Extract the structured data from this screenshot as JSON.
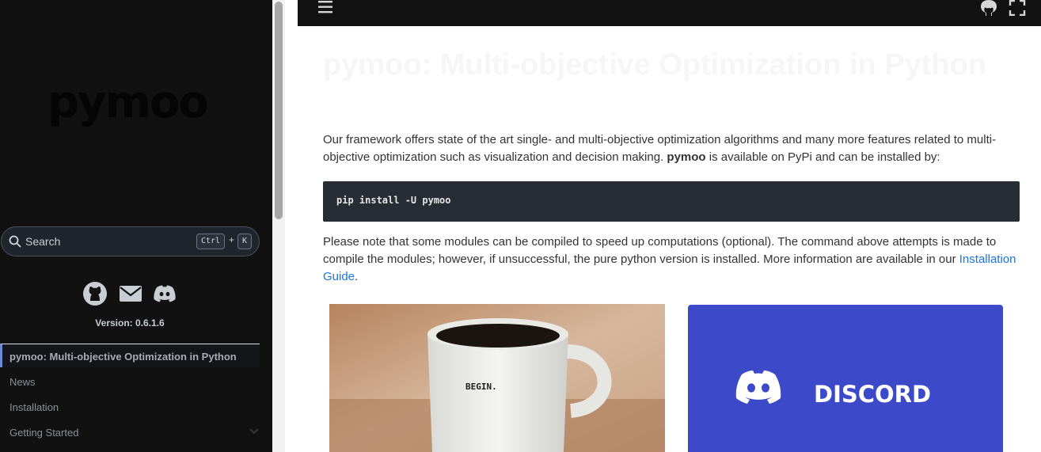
{
  "sidebar": {
    "logo_text": "pymoo",
    "search": {
      "placeholder": "Search",
      "shortcut_key1": "Ctrl",
      "shortcut_plus": "+",
      "shortcut_key2": "K"
    },
    "social_icons": [
      "github-icon",
      "mail-icon",
      "discord-icon"
    ],
    "version": "Version: 0.6.1.6",
    "nav": [
      {
        "label": "pymoo: Multi-objective Optimization in Python",
        "active": true
      },
      {
        "label": "News",
        "active": false
      },
      {
        "label": "Installation",
        "active": false
      },
      {
        "label": "Getting Started",
        "active": false,
        "expandable": true
      }
    ]
  },
  "header": {
    "icons": [
      "menu-icon",
      "github-icon",
      "fullscreen-icon"
    ]
  },
  "main": {
    "title": "pymoo: Multi-objective Optimization in Python",
    "intro_part1": "Our framework offers state of the art single- and multi-objective optimization algorithms and many more features related to multi-objective optimization such as visualization and decision making. ",
    "intro_bold": "pymoo",
    "intro_part2": " is available on PyPi and can be installed by:",
    "code": "pip install -U pymoo",
    "note": "Please note that some modules can be compiled to speed up computations (optional). The command above attempts is made to compile the modules; however, if unsuccessful, the pure python version is installed. More information are available in our ",
    "note_link": "Installation Guide",
    "note_end": ".",
    "cards": {
      "mug_text": "BEGIN.",
      "discord_text": "DISCORD"
    }
  },
  "colors": {
    "sidebar_bg": "#111112",
    "header_bg": "#121212",
    "code_bg": "#282c34",
    "link": "#1a73e8",
    "discord_blue": "#3c4ac9"
  }
}
